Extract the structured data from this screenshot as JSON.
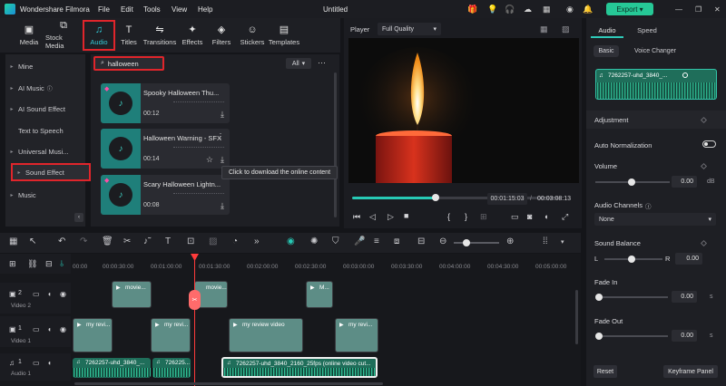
{
  "app": {
    "title": "Wondershare Filmora",
    "doc_title": "Untitled",
    "menu": [
      "File",
      "Edit",
      "Tools",
      "View",
      "Help"
    ],
    "export_label": "Export"
  },
  "nav": {
    "tabs": [
      {
        "label": "Media",
        "icon": "media-icon"
      },
      {
        "label": "Stock Media",
        "icon": "stock-media-icon"
      },
      {
        "label": "Audio",
        "icon": "music-note-icon",
        "active": true
      },
      {
        "label": "Titles",
        "icon": "titles-icon"
      },
      {
        "label": "Transitions",
        "icon": "transitions-icon"
      },
      {
        "label": "Effects",
        "icon": "effects-icon"
      },
      {
        "label": "Filters",
        "icon": "filters-icon"
      },
      {
        "label": "Stickers",
        "icon": "stickers-icon"
      },
      {
        "label": "Templates",
        "icon": "templates-icon"
      }
    ]
  },
  "sidebar": {
    "items": [
      {
        "label": "Mine"
      },
      {
        "label": "AI Music"
      },
      {
        "label": "AI Sound Effect"
      },
      {
        "label": "Text to Speech"
      },
      {
        "label": "Universal Musi..."
      },
      {
        "label": "Sound Effect",
        "selected": true
      },
      {
        "label": "Music"
      }
    ]
  },
  "search": {
    "value": "halloween",
    "filter": "All"
  },
  "results": [
    {
      "title": "Spooky Halloween Thu...",
      "duration": "00:12"
    },
    {
      "title": "Halloween Warning - SFX",
      "duration": "00:14"
    },
    {
      "title": "Scary Halloween Lightn...",
      "duration": "00:08"
    }
  ],
  "tooltip": "Click to download the online content",
  "player": {
    "label": "Player",
    "quality": "Full Quality",
    "current_time": "00:01:15:03",
    "total_time": "00:03:08:13",
    "progress": 0.4
  },
  "right_panel": {
    "tabs": [
      "Audio",
      "Speed"
    ],
    "subtabs": [
      "Basic",
      "Voice Changer"
    ],
    "clip_name": "7262257-uhd_3840_...",
    "adjustment": "Adjustment",
    "auto_norm": "Auto Normalization",
    "volume": {
      "label": "Volume",
      "value": "0.00",
      "unit": "dB"
    },
    "channels": {
      "label": "Audio Channels",
      "value": "None"
    },
    "balance": {
      "label": "Sound Balance",
      "left": "L",
      "right": "R",
      "value": "0.00"
    },
    "fade_in": {
      "label": "Fade In",
      "value": "0.00",
      "unit": "s"
    },
    "fade_out": {
      "label": "Fade Out",
      "value": "0.00",
      "unit": "s"
    },
    "reset": "Reset",
    "keyframe": "Keyframe Panel"
  },
  "timeline": {
    "ticks": [
      "00:00",
      "00:00:30:00",
      "00:01:00:00",
      "00:01:30:00",
      "00:02:00:00",
      "00:02:30:00",
      "00:03:00:00",
      "00:03:30:00",
      "00:04:00:00",
      "00:04:30:00",
      "00:05:00:00"
    ],
    "tracks": [
      {
        "name": "Video 2",
        "num": "2"
      },
      {
        "name": "Video 1",
        "num": "1"
      },
      {
        "name": "Audio 1",
        "num": "1"
      }
    ],
    "video2_clips": [
      "movie...",
      "movie...",
      "M..."
    ],
    "video1_clips": [
      "my revi...",
      "my revi...",
      "my review video",
      "my revi..."
    ],
    "audio_clips": [
      "7262257-uhd_3840_...",
      "726225...",
      "7262257-uhd_3840_2160_25fps (online video cut..."
    ]
  }
}
